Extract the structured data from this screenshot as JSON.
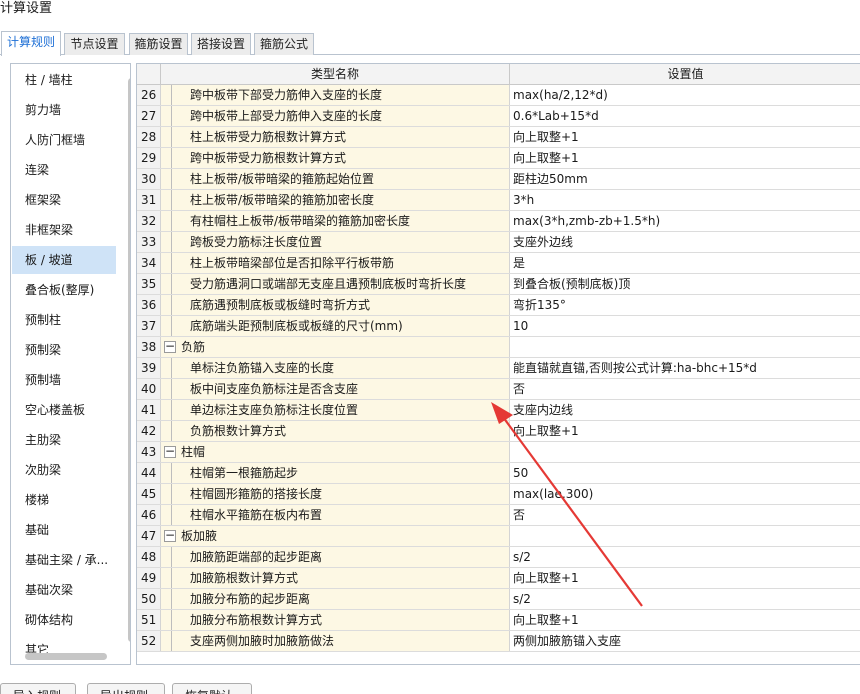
{
  "window": {
    "title": "计算设置"
  },
  "tabs": [
    {
      "label": "计算规则",
      "active": true
    },
    {
      "label": "节点设置",
      "active": false
    },
    {
      "label": "箍筋设置",
      "active": false
    },
    {
      "label": "搭接设置",
      "active": false
    },
    {
      "label": "箍筋公式",
      "active": false
    }
  ],
  "sidebar": {
    "items": [
      {
        "label": "柱 / 墙柱"
      },
      {
        "label": "剪力墙"
      },
      {
        "label": "人防门框墙"
      },
      {
        "label": "连梁"
      },
      {
        "label": "框架梁"
      },
      {
        "label": "非框架梁"
      },
      {
        "label": "板 / 坡道",
        "selected": true
      },
      {
        "label": "叠合板(整厚)"
      },
      {
        "label": "预制柱"
      },
      {
        "label": "预制梁"
      },
      {
        "label": "预制墙"
      },
      {
        "label": "空心楼盖板"
      },
      {
        "label": "主肋梁"
      },
      {
        "label": "次肋梁"
      },
      {
        "label": "楼梯"
      },
      {
        "label": "基础"
      },
      {
        "label": "基础主梁 / 承..."
      },
      {
        "label": "基础次梁"
      },
      {
        "label": "砌体结构"
      },
      {
        "label": "其它"
      }
    ]
  },
  "grid": {
    "headers": {
      "name": "类型名称",
      "value": "设置值"
    },
    "rows": [
      {
        "num": "26",
        "type": "child",
        "name": "跨中板带下部受力筋伸入支座的长度",
        "value": "max(ha/2,12*d)"
      },
      {
        "num": "27",
        "type": "child",
        "name": "跨中板带上部受力筋伸入支座的长度",
        "value": "0.6*Lab+15*d"
      },
      {
        "num": "28",
        "type": "child",
        "name": "柱上板带受力筋根数计算方式",
        "value": "向上取整+1"
      },
      {
        "num": "29",
        "type": "child",
        "name": "跨中板带受力筋根数计算方式",
        "value": "向上取整+1"
      },
      {
        "num": "30",
        "type": "child",
        "name": "柱上板带/板带暗梁的箍筋起始位置",
        "value": "距柱边50mm"
      },
      {
        "num": "31",
        "type": "child",
        "name": "柱上板带/板带暗梁的箍筋加密长度",
        "value": "3*h"
      },
      {
        "num": "32",
        "type": "child",
        "name": "有柱帽柱上板带/板带暗梁的箍筋加密长度",
        "value": "max(3*h,zmb-zb+1.5*h)"
      },
      {
        "num": "33",
        "type": "child",
        "name": "跨板受力筋标注长度位置",
        "value": "支座外边线"
      },
      {
        "num": "34",
        "type": "child",
        "name": "柱上板带暗梁部位是否扣除平行板带筋",
        "value": "是"
      },
      {
        "num": "35",
        "type": "child",
        "name": "受力筋遇洞口或端部无支座且遇预制底板时弯折长度",
        "value": "到叠合板(预制底板)顶"
      },
      {
        "num": "36",
        "type": "child",
        "name": "底筋遇预制底板或板缝时弯折方式",
        "value": "弯折135°"
      },
      {
        "num": "37",
        "type": "child",
        "name": "底筋端头距预制底板或板缝的尺寸(mm)",
        "value": "10"
      },
      {
        "num": "38",
        "type": "group",
        "name": "负筋",
        "value": ""
      },
      {
        "num": "39",
        "type": "child",
        "name": "单标注负筋锚入支座的长度",
        "value": "能直锚就直锚,否则按公式计算:ha-bhc+15*d"
      },
      {
        "num": "40",
        "type": "child",
        "name": "板中间支座负筋标注是否含支座",
        "value": "否"
      },
      {
        "num": "41",
        "type": "child",
        "name": "单边标注支座负筋标注长度位置",
        "value": "支座内边线"
      },
      {
        "num": "42",
        "type": "child",
        "name": "负筋根数计算方式",
        "value": "向上取整+1"
      },
      {
        "num": "43",
        "type": "group",
        "name": "柱帽",
        "value": ""
      },
      {
        "num": "44",
        "type": "child",
        "name": "柱帽第一根箍筋起步",
        "value": "50"
      },
      {
        "num": "45",
        "type": "child",
        "name": "柱帽圆形箍筋的搭接长度",
        "value": "max(lae,300)"
      },
      {
        "num": "46",
        "type": "child",
        "name": "柱帽水平箍筋在板内布置",
        "value": "否"
      },
      {
        "num": "47",
        "type": "group",
        "name": "板加腋",
        "value": ""
      },
      {
        "num": "48",
        "type": "child",
        "name": "加腋筋距端部的起步距离",
        "value": "s/2"
      },
      {
        "num": "49",
        "type": "child",
        "name": "加腋筋根数计算方式",
        "value": "向上取整+1"
      },
      {
        "num": "50",
        "type": "child",
        "name": "加腋分布筋的起步距离",
        "value": "s/2"
      },
      {
        "num": "51",
        "type": "child",
        "name": "加腋分布筋根数计算方式",
        "value": "向上取整+1"
      },
      {
        "num": "52",
        "type": "child",
        "name": "支座两侧加腋时加腋筋做法",
        "value": "两侧加腋筋锚入支座"
      }
    ]
  },
  "footer": {
    "buttons": [
      {
        "label": "导入规则"
      },
      {
        "label": "导出规则"
      },
      {
        "label": "恢复默认值"
      }
    ]
  },
  "icons": {
    "collapse": "minus-box-icon"
  },
  "colors": {
    "accent": "#1d6fd6",
    "selected_bg": "#cfe3f7",
    "name_bg": "#fdf8e4",
    "annotation": "#e53935"
  }
}
